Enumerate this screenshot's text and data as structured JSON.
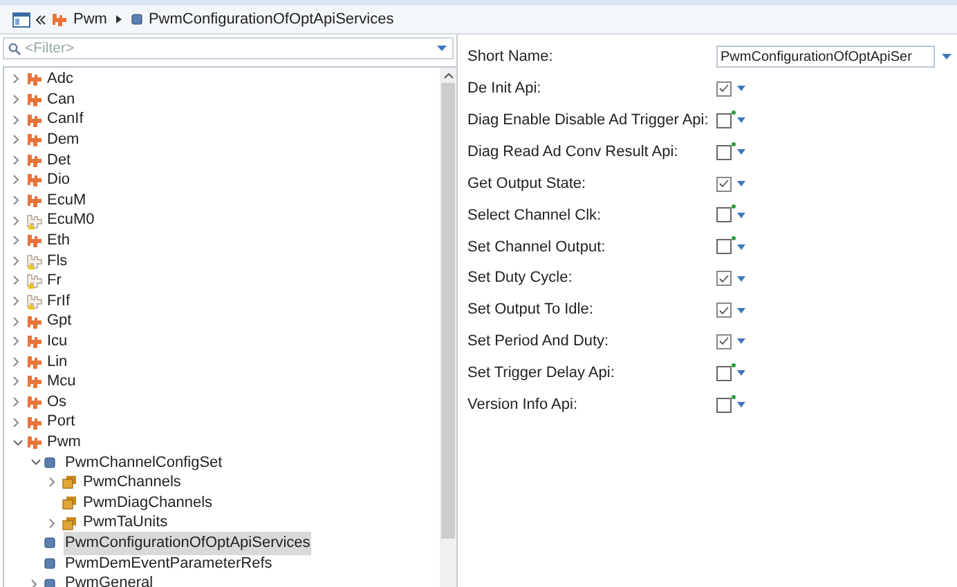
{
  "breadcrumb": [
    {
      "label": "Pwm",
      "kind": "module"
    },
    {
      "label": "PwmConfigurationOfOptApiServices",
      "kind": "container"
    }
  ],
  "filter": {
    "placeholder": "<Filter>"
  },
  "tree": [
    {
      "label": "Adc",
      "kind": "module",
      "expanded": false,
      "selected": false
    },
    {
      "label": "Can",
      "kind": "module",
      "expanded": false,
      "selected": false
    },
    {
      "label": "CanIf",
      "kind": "module",
      "expanded": false,
      "selected": false
    },
    {
      "label": "Dem",
      "kind": "module",
      "expanded": false,
      "selected": false
    },
    {
      "label": "Det",
      "kind": "module",
      "expanded": false,
      "selected": false
    },
    {
      "label": "Dio",
      "kind": "module",
      "expanded": false,
      "selected": false
    },
    {
      "label": "EcuM",
      "kind": "module",
      "expanded": false,
      "selected": false
    },
    {
      "label": "EcuM0",
      "kind": "inactive",
      "expanded": false,
      "selected": false
    },
    {
      "label": "Eth",
      "kind": "module",
      "expanded": false,
      "selected": false
    },
    {
      "label": "Fls",
      "kind": "inactive",
      "expanded": false,
      "selected": false
    },
    {
      "label": "Fr",
      "kind": "inactive",
      "expanded": false,
      "selected": false
    },
    {
      "label": "FrIf",
      "kind": "inactive",
      "expanded": false,
      "selected": false
    },
    {
      "label": "Gpt",
      "kind": "module",
      "expanded": false,
      "selected": false
    },
    {
      "label": "Icu",
      "kind": "module",
      "expanded": false,
      "selected": false
    },
    {
      "label": "Lin",
      "kind": "module",
      "expanded": false,
      "selected": false
    },
    {
      "label": "Mcu",
      "kind": "module",
      "expanded": false,
      "selected": false
    },
    {
      "label": "Os",
      "kind": "module",
      "expanded": false,
      "selected": false
    },
    {
      "label": "Port",
      "kind": "module",
      "expanded": false,
      "selected": false
    },
    {
      "label": "Pwm",
      "kind": "module",
      "expanded": true,
      "selected": false,
      "children": [
        {
          "label": "PwmChannelConfigSet",
          "kind": "container",
          "expanded": true,
          "selected": false,
          "children": [
            {
              "label": "PwmChannels",
              "kind": "list",
              "expanded": false,
              "selected": false
            },
            {
              "label": "PwmDiagChannels",
              "kind": "list",
              "selected": false
            },
            {
              "label": "PwmTaUnits",
              "kind": "list",
              "expanded": false,
              "selected": false
            }
          ]
        },
        {
          "label": "PwmConfigurationOfOptApiServices",
          "kind": "container",
          "selected": true
        },
        {
          "label": "PwmDemEventParameterRefs",
          "kind": "container",
          "selected": false
        },
        {
          "label": "PwmGeneral",
          "kind": "container",
          "expanded": false,
          "selected": false
        }
      ]
    }
  ],
  "form": [
    {
      "kind": "text",
      "label": "Short Name:",
      "value": "PwmConfigurationOfOptApiSer"
    },
    {
      "kind": "checkbox",
      "label": "De Init Api:",
      "checked": true
    },
    {
      "kind": "checkbox",
      "label": "Diag Enable Disable Ad Trigger Api:",
      "checked": false
    },
    {
      "kind": "checkbox",
      "label": "Diag Read Ad Conv Result Api:",
      "checked": false
    },
    {
      "kind": "checkbox",
      "label": "Get Output State:",
      "checked": true
    },
    {
      "kind": "checkbox",
      "label": "Select Channel Clk:",
      "checked": false
    },
    {
      "kind": "checkbox",
      "label": "Set Channel Output:",
      "checked": false
    },
    {
      "kind": "checkbox",
      "label": "Set Duty Cycle:",
      "checked": true
    },
    {
      "kind": "checkbox",
      "label": "Set Output To Idle:",
      "checked": true
    },
    {
      "kind": "checkbox",
      "label": "Set Period And Duty:",
      "checked": true
    },
    {
      "kind": "checkbox",
      "label": "Set Trigger Delay Api:",
      "checked": false
    },
    {
      "kind": "checkbox",
      "label": "Version Info Api:",
      "checked": false
    }
  ]
}
